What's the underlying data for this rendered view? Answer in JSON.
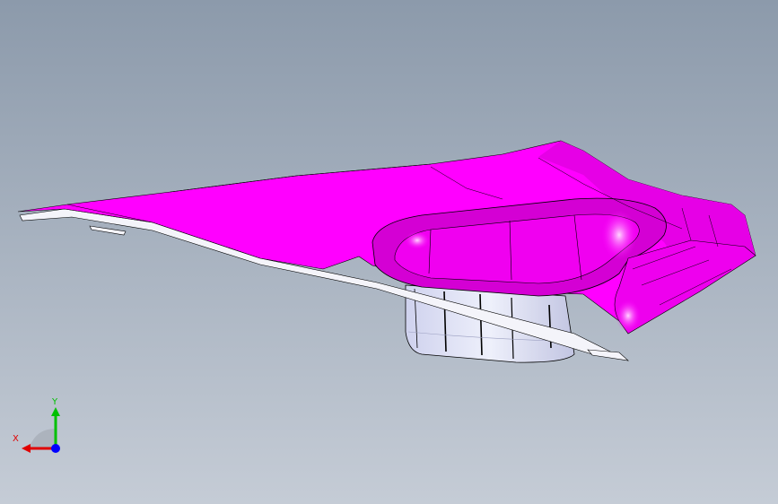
{
  "viewport": {
    "background_top": "#8c9aab",
    "background_bottom": "#c5ccd6"
  },
  "model": {
    "part_color": "#ff00ff",
    "part_shade": "#d400d4",
    "part_highlight": "#ff9cff",
    "underside_color": "#e4e6f8",
    "underside_shade": "#b8bcd6",
    "edge_color": "#000000"
  },
  "triad": {
    "x_label": "X",
    "y_label": "Y",
    "x_color": "#e00000",
    "y_color": "#00c000",
    "z_color": "#0000ff"
  }
}
